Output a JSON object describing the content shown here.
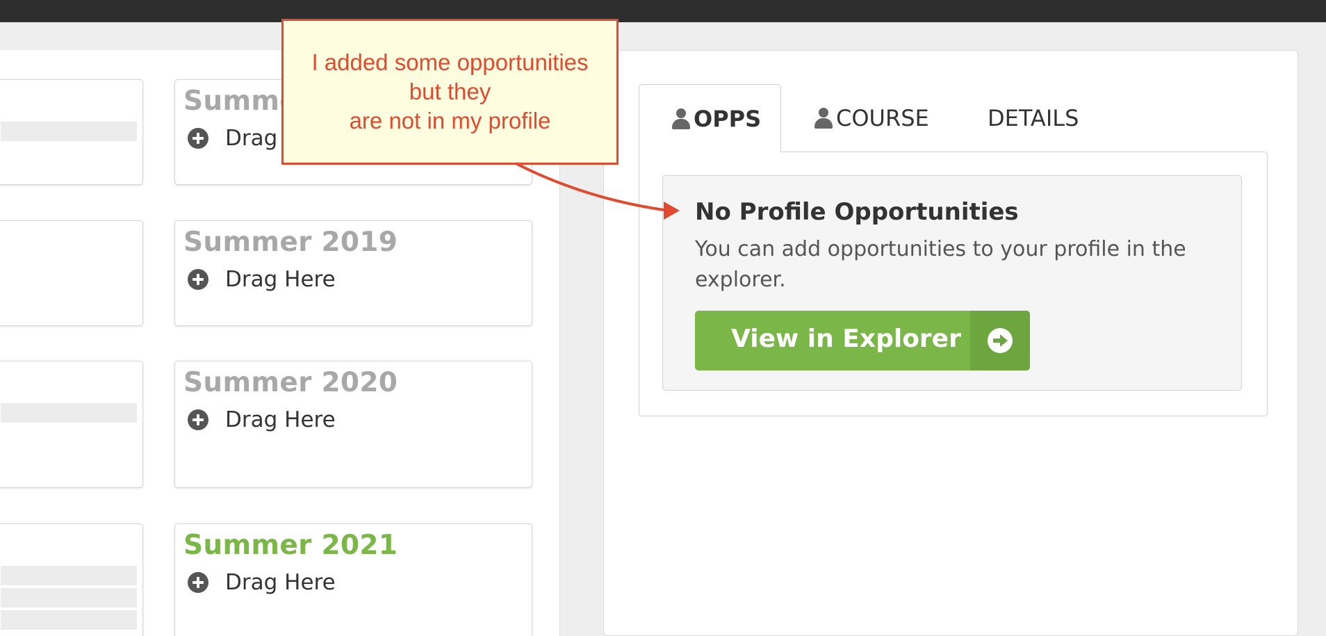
{
  "terms": {
    "summer_partial": "Summe",
    "summer_2019": "Summer 2019",
    "summer_2020": "Summer 2020",
    "summer_2021": "Summer 2021",
    "drag_partial": "Drag",
    "drag_label": "Drag Here"
  },
  "tabs": {
    "opps": "OPPS",
    "course": "COURSE",
    "details": "DETAILS"
  },
  "notice": {
    "title": "No Profile Opportunities",
    "text": "You can add opportunities to your profile in the explorer.",
    "button_label": "View in Explorer"
  },
  "annotation": {
    "text": "I added some opportunities\nbut they\nare not in my profile",
    "color": "#e04a2f"
  },
  "colors": {
    "accent": "#7ab648",
    "muted_term": "#a8a8a8"
  }
}
